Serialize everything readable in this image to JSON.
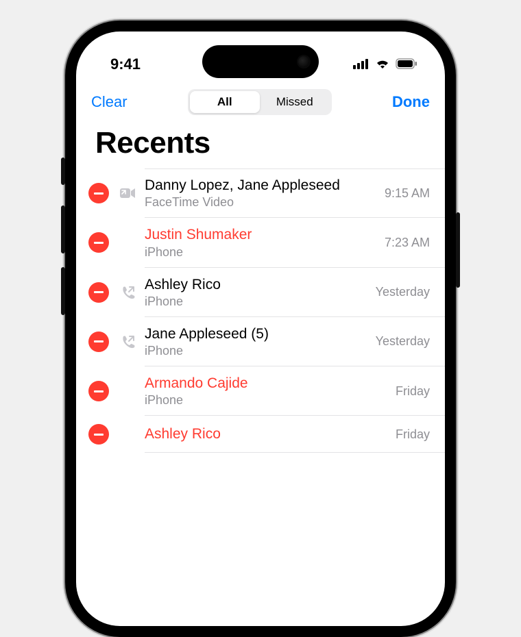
{
  "status": {
    "time": "9:41"
  },
  "nav": {
    "clear": "Clear",
    "done": "Done",
    "seg_all": "All",
    "seg_missed": "Missed"
  },
  "title": "Recents",
  "calls": [
    {
      "name": "Danny Lopez, Jane Appleseed",
      "sub": "FaceTime Video",
      "time": "9:15 AM",
      "missed": false,
      "icon": "video"
    },
    {
      "name": "Justin Shumaker",
      "sub": "iPhone",
      "time": "7:23 AM",
      "missed": true,
      "icon": "none"
    },
    {
      "name": "Ashley Rico",
      "sub": "iPhone",
      "time": "Yesterday",
      "missed": false,
      "icon": "out"
    },
    {
      "name": "Jane Appleseed (5)",
      "sub": "iPhone",
      "time": "Yesterday",
      "missed": false,
      "icon": "out"
    },
    {
      "name": "Armando Cajide",
      "sub": "iPhone",
      "time": "Friday",
      "missed": true,
      "icon": "none"
    },
    {
      "name": "Ashley Rico",
      "sub": "",
      "time": "Friday",
      "missed": true,
      "icon": "none"
    }
  ]
}
